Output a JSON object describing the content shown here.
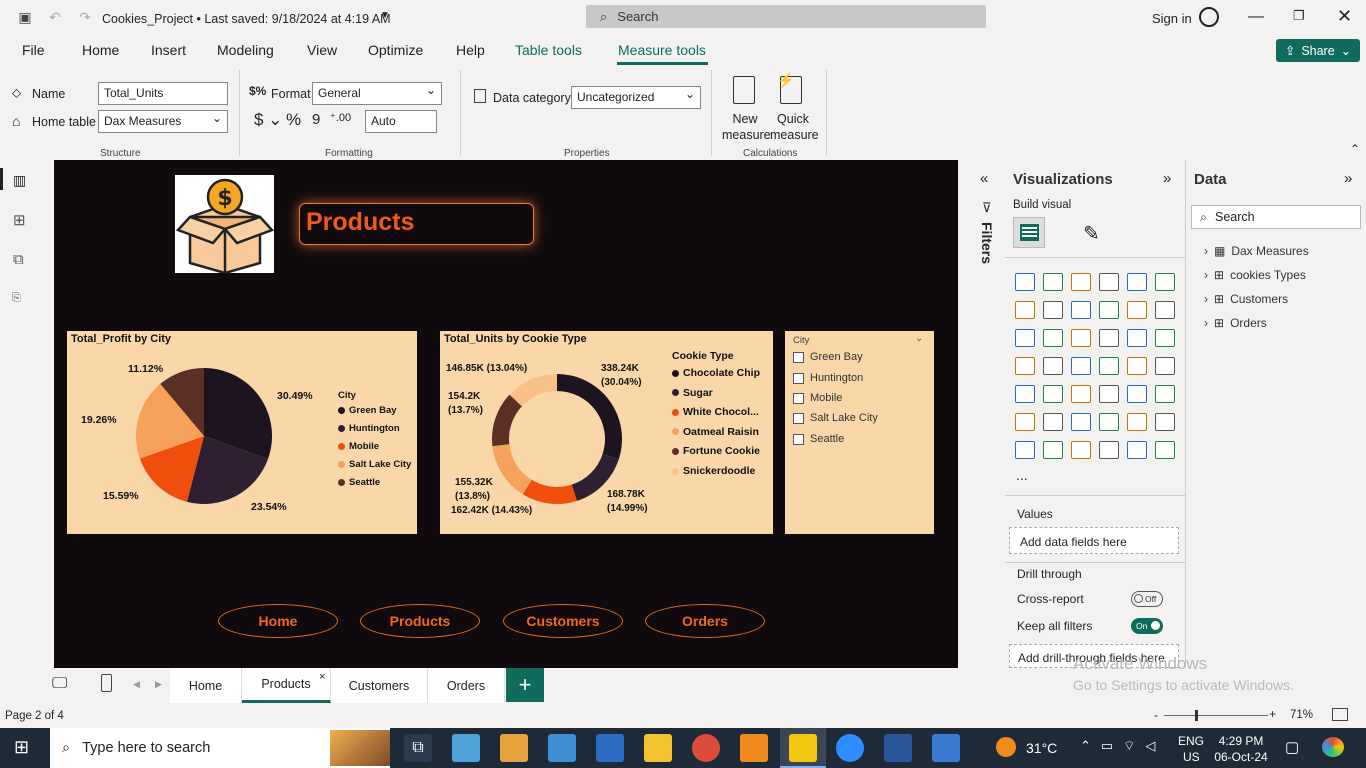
{
  "titlebar": {
    "title": "Cookies_Project • Last saved: 9/18/2024 at 4:19 AM",
    "search": "Search",
    "signin": "Sign in"
  },
  "menu": {
    "file": "File",
    "home": "Home",
    "insert": "Insert",
    "modeling": "Modeling",
    "view": "View",
    "optimize": "Optimize",
    "help": "Help",
    "table_tools": "Table tools",
    "measure_tools": "Measure tools",
    "share": "Share"
  },
  "ribbon": {
    "name_label": "Name",
    "name_value": "Total_Units",
    "home_table_label": "Home table",
    "home_table_value": "Dax Measures",
    "structure": "Structure",
    "format_label": "Format",
    "format_value": "General",
    "auto_value": "Auto",
    "formatting": "Formatting",
    "data_category_label": "Data category",
    "data_category_value": "Uncategorized",
    "properties": "Properties",
    "new_measure": [
      "New",
      "measure"
    ],
    "quick_measure": [
      "Quick",
      "measure"
    ],
    "calculations": "Calculations"
  },
  "report": {
    "page_title": "Products",
    "nav": [
      "Home",
      "Products",
      "Customers",
      "Orders"
    ],
    "slicer": {
      "title": "City",
      "items": [
        "Green Bay",
        "Huntington",
        "Mobile",
        "Salt Lake City",
        "Seattle"
      ]
    }
  },
  "chart_data": [
    {
      "type": "pie",
      "title": "Total_Profit by City",
      "legend_title": "City",
      "categories": [
        "Green Bay",
        "Huntington",
        "Mobile",
        "Salt Lake City",
        "Seattle"
      ],
      "values": [
        30.49,
        23.54,
        15.59,
        19.26,
        11.12
      ],
      "labels": [
        "30.49%",
        "23.54%",
        "15.59%",
        "19.26%",
        "11.12%"
      ],
      "colors": [
        "#1d1420",
        "#2e2030",
        "#f04e0c",
        "#f7a25c",
        "#5b3024"
      ]
    },
    {
      "type": "pie",
      "subtype": "donut",
      "title": "Total_Units by Cookie Type",
      "legend_title": "Cookie Type",
      "categories": [
        "Chocolate Chip",
        "Sugar",
        "White Chocol...",
        "Oatmeal Raisin",
        "Fortune Cookie",
        "Snickerdoodle"
      ],
      "values": [
        338.24,
        168.78,
        155.32,
        162.42,
        154.2,
        146.85
      ],
      "labels": [
        "338.24K\n(30.04%)",
        "168.78K\n(14.99%)",
        "155.32K\n(13.8%)",
        "162.42K (14.43%)",
        "154.2K\n(13.7%)",
        "146.85K (13.04%)"
      ],
      "colors": [
        "#1d1420",
        "#2e2030",
        "#f04e0c",
        "#f7a25c",
        "#5b3024",
        "#f9c08a"
      ]
    }
  ],
  "filters": {
    "label": "Filters"
  },
  "viz": {
    "title": "Visualizations",
    "build": "Build visual",
    "values": "Values",
    "add_data": "Add data fields here",
    "drill": "Drill through",
    "cross": "Cross-report",
    "cross_state": "Off",
    "keep": "Keep all filters",
    "keep_state": "On",
    "add_drill": "Add drill-through fields here",
    "more": "..."
  },
  "data": {
    "title": "Data",
    "search": "Search",
    "fields": [
      "Dax Measures",
      "cookies Types",
      "Customers",
      "Orders"
    ]
  },
  "tabs": [
    "Home",
    "Products",
    "Customers",
    "Orders"
  ],
  "status": {
    "page": "Page 2 of 4",
    "zoom": "71%",
    "watermark1": "Activate Windows",
    "watermark2": "Go to Settings to activate Windows."
  },
  "taskbar": {
    "search": "Type here to search",
    "temp": "31°C",
    "lang1": "ENG",
    "lang2": "US",
    "time": "4:29 PM",
    "date": "06-Oct-24"
  }
}
